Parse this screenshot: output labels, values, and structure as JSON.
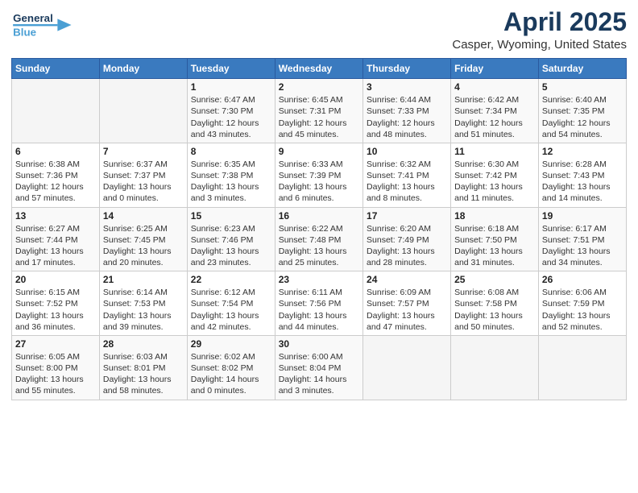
{
  "header": {
    "logo_text_general": "General",
    "logo_text_blue": "Blue",
    "month": "April 2025",
    "location": "Casper, Wyoming, United States"
  },
  "weekdays": [
    "Sunday",
    "Monday",
    "Tuesday",
    "Wednesday",
    "Thursday",
    "Friday",
    "Saturday"
  ],
  "weeks": [
    [
      {
        "day": "",
        "sunrise": "",
        "sunset": "",
        "daylight": ""
      },
      {
        "day": "",
        "sunrise": "",
        "sunset": "",
        "daylight": ""
      },
      {
        "day": "1",
        "sunrise": "Sunrise: 6:47 AM",
        "sunset": "Sunset: 7:30 PM",
        "daylight": "Daylight: 12 hours and 43 minutes."
      },
      {
        "day": "2",
        "sunrise": "Sunrise: 6:45 AM",
        "sunset": "Sunset: 7:31 PM",
        "daylight": "Daylight: 12 hours and 45 minutes."
      },
      {
        "day": "3",
        "sunrise": "Sunrise: 6:44 AM",
        "sunset": "Sunset: 7:33 PM",
        "daylight": "Daylight: 12 hours and 48 minutes."
      },
      {
        "day": "4",
        "sunrise": "Sunrise: 6:42 AM",
        "sunset": "Sunset: 7:34 PM",
        "daylight": "Daylight: 12 hours and 51 minutes."
      },
      {
        "day": "5",
        "sunrise": "Sunrise: 6:40 AM",
        "sunset": "Sunset: 7:35 PM",
        "daylight": "Daylight: 12 hours and 54 minutes."
      }
    ],
    [
      {
        "day": "6",
        "sunrise": "Sunrise: 6:38 AM",
        "sunset": "Sunset: 7:36 PM",
        "daylight": "Daylight: 12 hours and 57 minutes."
      },
      {
        "day": "7",
        "sunrise": "Sunrise: 6:37 AM",
        "sunset": "Sunset: 7:37 PM",
        "daylight": "Daylight: 13 hours and 0 minutes."
      },
      {
        "day": "8",
        "sunrise": "Sunrise: 6:35 AM",
        "sunset": "Sunset: 7:38 PM",
        "daylight": "Daylight: 13 hours and 3 minutes."
      },
      {
        "day": "9",
        "sunrise": "Sunrise: 6:33 AM",
        "sunset": "Sunset: 7:39 PM",
        "daylight": "Daylight: 13 hours and 6 minutes."
      },
      {
        "day": "10",
        "sunrise": "Sunrise: 6:32 AM",
        "sunset": "Sunset: 7:41 PM",
        "daylight": "Daylight: 13 hours and 8 minutes."
      },
      {
        "day": "11",
        "sunrise": "Sunrise: 6:30 AM",
        "sunset": "Sunset: 7:42 PM",
        "daylight": "Daylight: 13 hours and 11 minutes."
      },
      {
        "day": "12",
        "sunrise": "Sunrise: 6:28 AM",
        "sunset": "Sunset: 7:43 PM",
        "daylight": "Daylight: 13 hours and 14 minutes."
      }
    ],
    [
      {
        "day": "13",
        "sunrise": "Sunrise: 6:27 AM",
        "sunset": "Sunset: 7:44 PM",
        "daylight": "Daylight: 13 hours and 17 minutes."
      },
      {
        "day": "14",
        "sunrise": "Sunrise: 6:25 AM",
        "sunset": "Sunset: 7:45 PM",
        "daylight": "Daylight: 13 hours and 20 minutes."
      },
      {
        "day": "15",
        "sunrise": "Sunrise: 6:23 AM",
        "sunset": "Sunset: 7:46 PM",
        "daylight": "Daylight: 13 hours and 23 minutes."
      },
      {
        "day": "16",
        "sunrise": "Sunrise: 6:22 AM",
        "sunset": "Sunset: 7:48 PM",
        "daylight": "Daylight: 13 hours and 25 minutes."
      },
      {
        "day": "17",
        "sunrise": "Sunrise: 6:20 AM",
        "sunset": "Sunset: 7:49 PM",
        "daylight": "Daylight: 13 hours and 28 minutes."
      },
      {
        "day": "18",
        "sunrise": "Sunrise: 6:18 AM",
        "sunset": "Sunset: 7:50 PM",
        "daylight": "Daylight: 13 hours and 31 minutes."
      },
      {
        "day": "19",
        "sunrise": "Sunrise: 6:17 AM",
        "sunset": "Sunset: 7:51 PM",
        "daylight": "Daylight: 13 hours and 34 minutes."
      }
    ],
    [
      {
        "day": "20",
        "sunrise": "Sunrise: 6:15 AM",
        "sunset": "Sunset: 7:52 PM",
        "daylight": "Daylight: 13 hours and 36 minutes."
      },
      {
        "day": "21",
        "sunrise": "Sunrise: 6:14 AM",
        "sunset": "Sunset: 7:53 PM",
        "daylight": "Daylight: 13 hours and 39 minutes."
      },
      {
        "day": "22",
        "sunrise": "Sunrise: 6:12 AM",
        "sunset": "Sunset: 7:54 PM",
        "daylight": "Daylight: 13 hours and 42 minutes."
      },
      {
        "day": "23",
        "sunrise": "Sunrise: 6:11 AM",
        "sunset": "Sunset: 7:56 PM",
        "daylight": "Daylight: 13 hours and 44 minutes."
      },
      {
        "day": "24",
        "sunrise": "Sunrise: 6:09 AM",
        "sunset": "Sunset: 7:57 PM",
        "daylight": "Daylight: 13 hours and 47 minutes."
      },
      {
        "day": "25",
        "sunrise": "Sunrise: 6:08 AM",
        "sunset": "Sunset: 7:58 PM",
        "daylight": "Daylight: 13 hours and 50 minutes."
      },
      {
        "day": "26",
        "sunrise": "Sunrise: 6:06 AM",
        "sunset": "Sunset: 7:59 PM",
        "daylight": "Daylight: 13 hours and 52 minutes."
      }
    ],
    [
      {
        "day": "27",
        "sunrise": "Sunrise: 6:05 AM",
        "sunset": "Sunset: 8:00 PM",
        "daylight": "Daylight: 13 hours and 55 minutes."
      },
      {
        "day": "28",
        "sunrise": "Sunrise: 6:03 AM",
        "sunset": "Sunset: 8:01 PM",
        "daylight": "Daylight: 13 hours and 58 minutes."
      },
      {
        "day": "29",
        "sunrise": "Sunrise: 6:02 AM",
        "sunset": "Sunset: 8:02 PM",
        "daylight": "Daylight: 14 hours and 0 minutes."
      },
      {
        "day": "30",
        "sunrise": "Sunrise: 6:00 AM",
        "sunset": "Sunset: 8:04 PM",
        "daylight": "Daylight: 14 hours and 3 minutes."
      },
      {
        "day": "",
        "sunrise": "",
        "sunset": "",
        "daylight": ""
      },
      {
        "day": "",
        "sunrise": "",
        "sunset": "",
        "daylight": ""
      },
      {
        "day": "",
        "sunrise": "",
        "sunset": "",
        "daylight": ""
      }
    ]
  ]
}
